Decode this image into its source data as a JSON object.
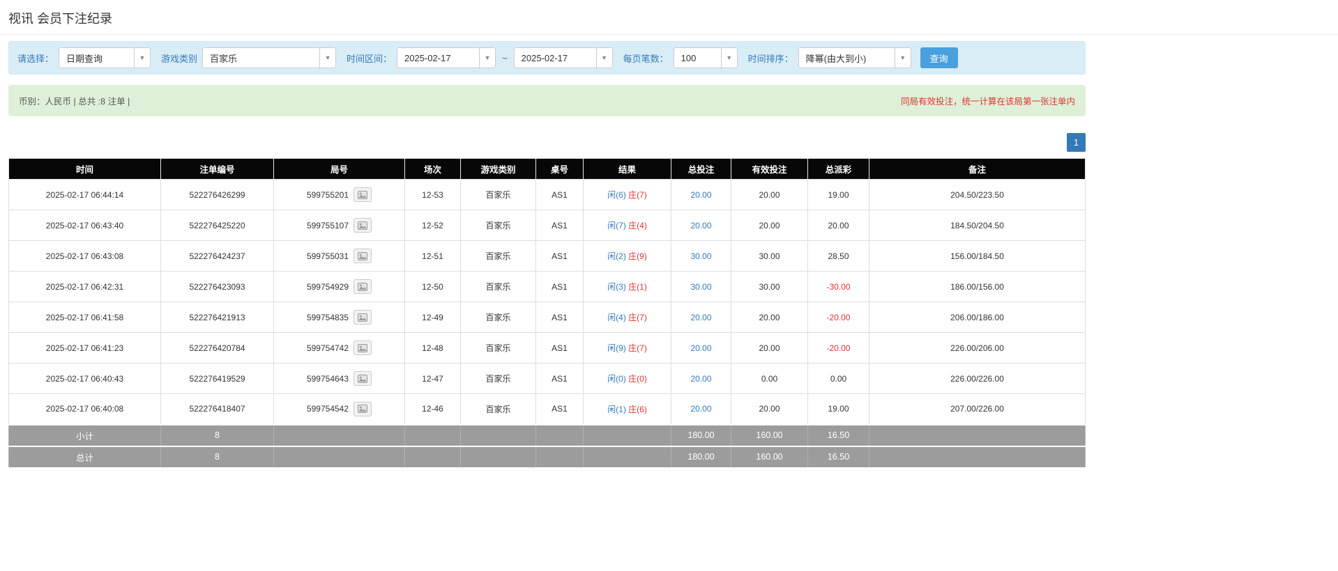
{
  "page": {
    "title": "视讯 会员下注纪录"
  },
  "filters": {
    "select_label": "请选择：",
    "select_value": "日期查询",
    "game_label": "游戏类别",
    "game_value": "百家乐",
    "range_label": "时间区间：",
    "date_from": "2025-02-17",
    "range_separator": "~",
    "date_to": "2025-02-17",
    "page_size_label": "每页笔数：",
    "page_size_value": "100",
    "sort_label": "时间排序：",
    "sort_value": "降幂(由大到小)",
    "search_button": "查询"
  },
  "summary": {
    "left": "币别：人民币 | 总共 :8 注单 |",
    "right": "同局有效投注，统一计算在该局第一张注单内"
  },
  "pagination": {
    "current": "1"
  },
  "table": {
    "headers": [
      "时间",
      "注单编号",
      "局号",
      "场次",
      "游戏类别",
      "桌号",
      "结果",
      "总投注",
      "有效投注",
      "总派彩",
      "备注"
    ],
    "rows": [
      {
        "time": "2025-02-17 06:44:14",
        "bet_id": "522276426299",
        "round_id": "599755201",
        "session": "12-53",
        "game": "百家乐",
        "table": "AS1",
        "player": "闲(6)",
        "banker": "庄(7)",
        "total_bet": "20.00",
        "valid_bet": "20.00",
        "payout": "19.00",
        "payout_negative": false,
        "remark": "204.50/223.50"
      },
      {
        "time": "2025-02-17 06:43:40",
        "bet_id": "522276425220",
        "round_id": "599755107",
        "session": "12-52",
        "game": "百家乐",
        "table": "AS1",
        "player": "闲(7)",
        "banker": "庄(4)",
        "total_bet": "20.00",
        "valid_bet": "20.00",
        "payout": "20.00",
        "payout_negative": false,
        "remark": "184.50/204.50"
      },
      {
        "time": "2025-02-17 06:43:08",
        "bet_id": "522276424237",
        "round_id": "599755031",
        "session": "12-51",
        "game": "百家乐",
        "table": "AS1",
        "player": "闲(2)",
        "banker": "庄(9)",
        "total_bet": "30.00",
        "valid_bet": "30.00",
        "payout": "28.50",
        "payout_negative": false,
        "remark": "156.00/184.50"
      },
      {
        "time": "2025-02-17 06:42:31",
        "bet_id": "522276423093",
        "round_id": "599754929",
        "session": "12-50",
        "game": "百家乐",
        "table": "AS1",
        "player": "闲(3)",
        "banker": "庄(1)",
        "total_bet": "30.00",
        "valid_bet": "30.00",
        "payout": "-30.00",
        "payout_negative": true,
        "remark": "186.00/156.00"
      },
      {
        "time": "2025-02-17 06:41:58",
        "bet_id": "522276421913",
        "round_id": "599754835",
        "session": "12-49",
        "game": "百家乐",
        "table": "AS1",
        "player": "闲(4)",
        "banker": "庄(7)",
        "total_bet": "20.00",
        "valid_bet": "20.00",
        "payout": "-20.00",
        "payout_negative": true,
        "remark": "206.00/186.00"
      },
      {
        "time": "2025-02-17 06:41:23",
        "bet_id": "522276420784",
        "round_id": "599754742",
        "session": "12-48",
        "game": "百家乐",
        "table": "AS1",
        "player": "闲(9)",
        "banker": "庄(7)",
        "total_bet": "20.00",
        "valid_bet": "20.00",
        "payout": "-20.00",
        "payout_negative": true,
        "remark": "226.00/206.00"
      },
      {
        "time": "2025-02-17 06:40:43",
        "bet_id": "522276419529",
        "round_id": "599754643",
        "session": "12-47",
        "game": "百家乐",
        "table": "AS1",
        "player": "闲(0)",
        "banker": "庄(0)",
        "total_bet": "20.00",
        "valid_bet": "0.00",
        "payout": "0.00",
        "payout_negative": false,
        "remark": "226.00/226.00"
      },
      {
        "time": "2025-02-17 06:40:08",
        "bet_id": "522276418407",
        "round_id": "599754542",
        "session": "12-46",
        "game": "百家乐",
        "table": "AS1",
        "player": "闲(1)",
        "banker": "庄(6)",
        "total_bet": "20.00",
        "valid_bet": "20.00",
        "payout": "19.00",
        "payout_negative": false,
        "remark": "207.00/226.00"
      }
    ],
    "footer": [
      {
        "label": "小计",
        "count": "8",
        "total_bet": "180.00",
        "valid_bet": "160.00",
        "payout": "16.50"
      },
      {
        "label": "总计",
        "count": "8",
        "total_bet": "180.00",
        "valid_bet": "160.00",
        "payout": "16.50"
      }
    ]
  }
}
